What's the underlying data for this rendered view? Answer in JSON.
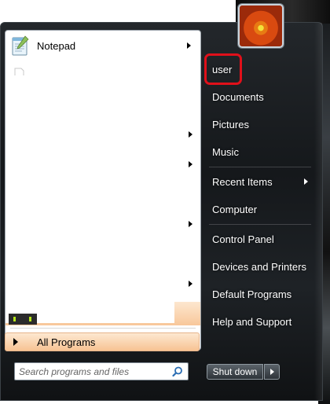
{
  "programs": {
    "items": [
      {
        "label": "Notepad",
        "has_arrow": true
      }
    ],
    "all_programs_label": "All Programs"
  },
  "search": {
    "placeholder": "Search programs and files"
  },
  "right_nav": {
    "items": [
      {
        "label": "user"
      },
      {
        "label": "Documents"
      },
      {
        "label": "Pictures"
      },
      {
        "label": "Music"
      },
      {
        "label": "Recent Items",
        "has_arrow": true
      },
      {
        "label": "Computer"
      },
      {
        "label": "Control Panel"
      },
      {
        "label": "Devices and Printers"
      },
      {
        "label": "Default Programs"
      },
      {
        "label": "Help and Support"
      }
    ]
  },
  "shutdown": {
    "label": "Shut down"
  },
  "colors": {
    "highlight": "#e0101a",
    "menu_dark": "#15181b",
    "all_programs_bg": "#f7c393"
  },
  "icons": {
    "user_picture": "orange-flower-avatar",
    "notepad": "notepad-icon",
    "search": "search-icon"
  }
}
